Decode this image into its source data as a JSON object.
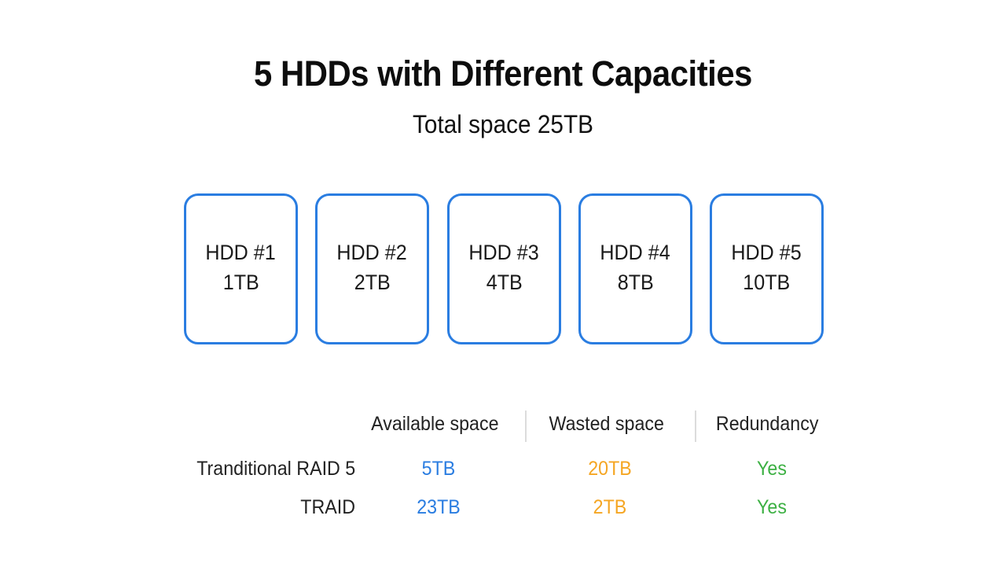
{
  "header": {
    "title": "5 HDDs with Different Capacities",
    "subtitle": "Total space 25TB"
  },
  "drives": [
    {
      "name": "HDD #1",
      "capacity": "1TB"
    },
    {
      "name": "HDD #2",
      "capacity": "2TB"
    },
    {
      "name": "HDD #3",
      "capacity": "4TB"
    },
    {
      "name": "HDD #4",
      "capacity": "8TB"
    },
    {
      "name": "HDD #5",
      "capacity": "10TB"
    }
  ],
  "comparison": {
    "columns": [
      "Available space",
      "Wasted space",
      "Redundancy"
    ],
    "rows": [
      {
        "label": "Tranditional RAID 5",
        "available": "5TB",
        "wasted": "20TB",
        "redundancy": "Yes"
      },
      {
        "label": "TRAID",
        "available": "23TB",
        "wasted": "2TB",
        "redundancy": "Yes"
      }
    ]
  },
  "colors": {
    "drive_border": "#2a7de1",
    "available": "#2a7de1",
    "wasted": "#f5a623",
    "redundancy": "#3cb043"
  }
}
